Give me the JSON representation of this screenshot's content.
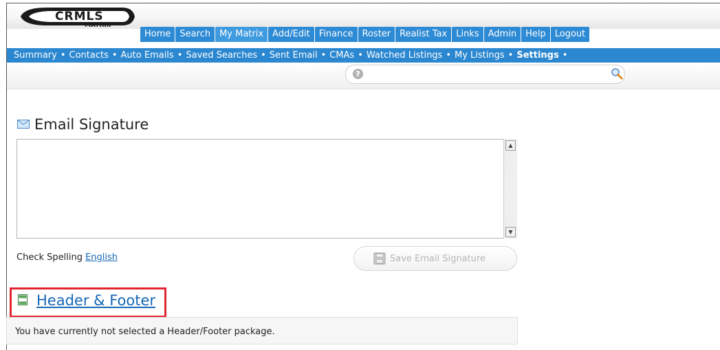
{
  "logo": {
    "text": "CRMLS",
    "subtext": "MATRIX"
  },
  "nav": {
    "tabs": [
      "Home",
      "Search",
      "My Matrix",
      "Add/Edit",
      "Finance",
      "Roster",
      "Realist Tax",
      "Links",
      "Admin",
      "Help",
      "Logout"
    ],
    "active": "My Matrix"
  },
  "subnav": {
    "items": [
      "Summary",
      "Contacts",
      "Auto Emails",
      "Saved Searches",
      "Sent Email",
      "CMAs",
      "Watched Listings",
      "My Listings",
      "Settings"
    ],
    "active": "Settings"
  },
  "search": {
    "help_icon": "question-icon",
    "search_icon": "magnifier-icon",
    "value": ""
  },
  "email_signature": {
    "title": "Email Signature",
    "icon": "envelope-icon",
    "value": "",
    "check_spelling_label": "Check Spelling",
    "language_link": "English",
    "save_button": "Save Email Signature"
  },
  "header_footer": {
    "title": "Header & Footer",
    "icon": "header-footer-icon",
    "message": "You have currently not selected a Header/Footer package."
  },
  "colors": {
    "nav_blue": "#2d8ad4",
    "link_blue": "#1566b5",
    "highlight_red": "#e1252f"
  }
}
